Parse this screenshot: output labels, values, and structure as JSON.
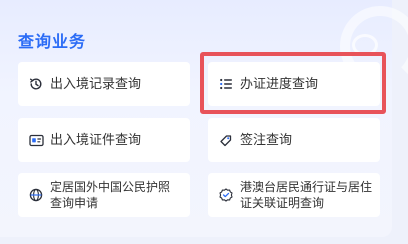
{
  "section": {
    "title": "查询业务"
  },
  "items": [
    {
      "label": "出入境记录查询",
      "icon": "history-clock-icon"
    },
    {
      "label": "办证进度查询",
      "icon": "list-progress-icon"
    },
    {
      "label": "出入境证件查询",
      "icon": "id-card-icon"
    },
    {
      "label": "签注查询",
      "icon": "tag-icon"
    },
    {
      "label": "定居国外中国公民护照查询申请",
      "icon": "globe-icon"
    },
    {
      "label": "港澳台居民通行证与居住证关联证明查询",
      "icon": "badge-check-icon"
    }
  ],
  "colors": {
    "accent": "#2b6cf6",
    "highlight": "#e8535a",
    "panel_bg": "#eef1fb"
  }
}
